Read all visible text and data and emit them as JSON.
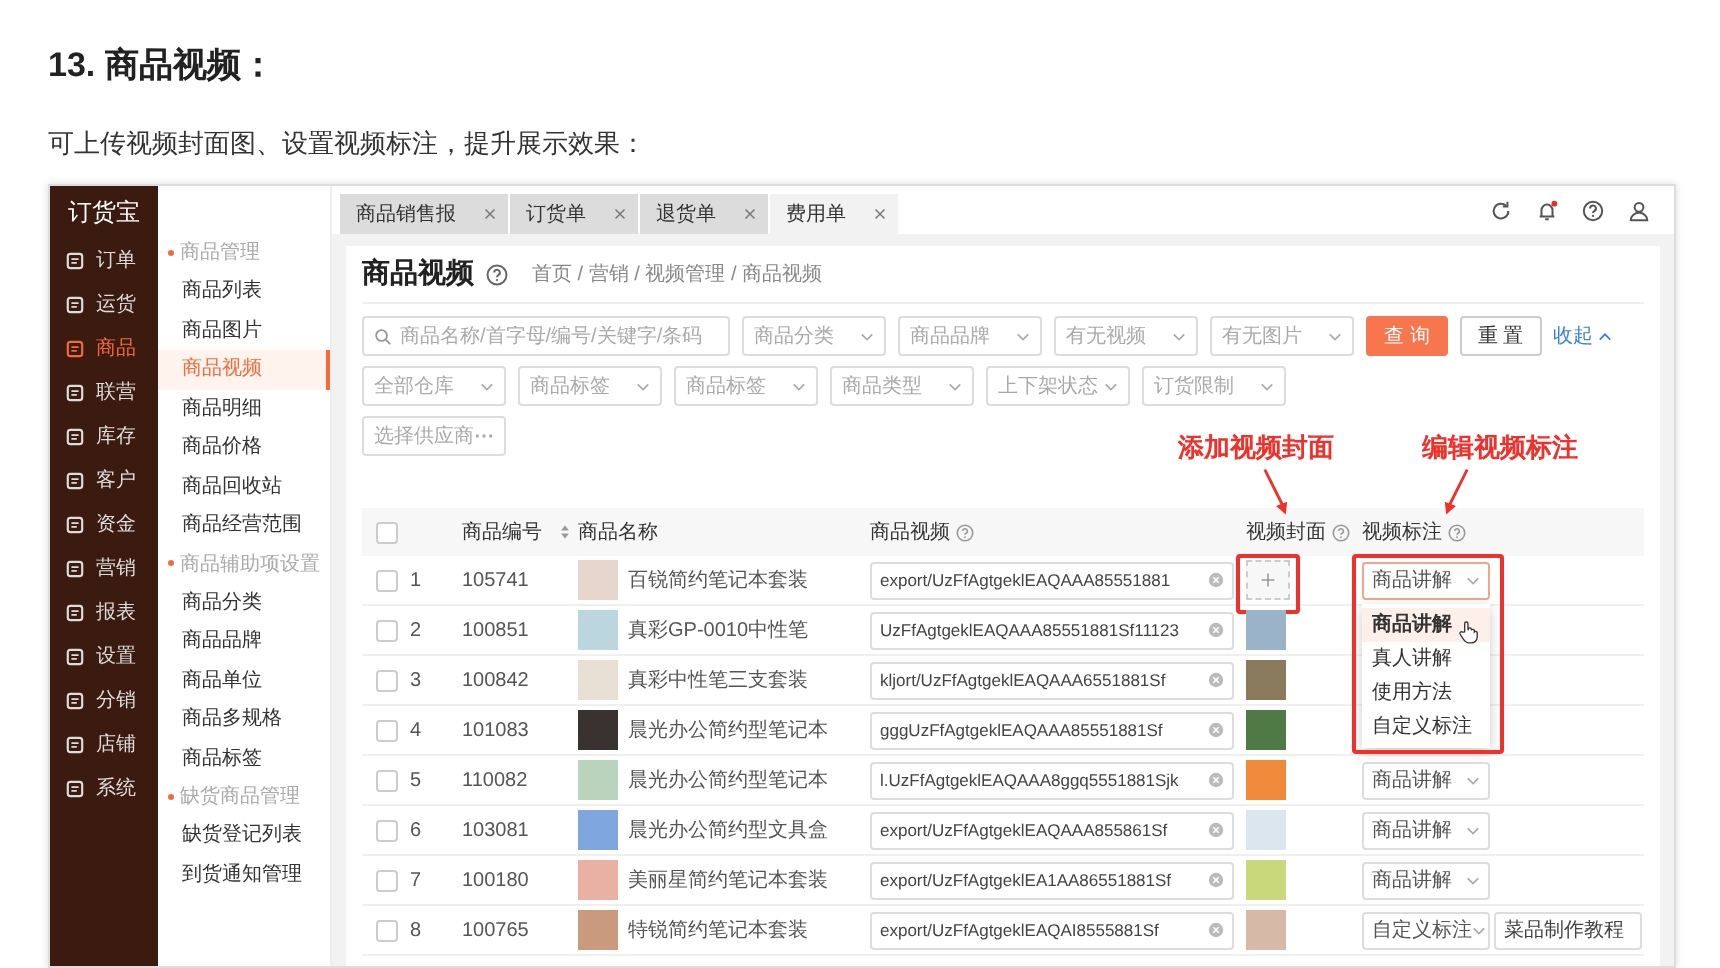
{
  "heading": "13. 商品视频：",
  "intro": "可上传视频封面图、设置视频标注，提升展示效果：",
  "app": {
    "logo": "订货宝",
    "nav": [
      {
        "label": "订单",
        "selected": false
      },
      {
        "label": "运货",
        "selected": false
      },
      {
        "label": "商品",
        "selected": true
      },
      {
        "label": "联营",
        "selected": false
      },
      {
        "label": "库存",
        "selected": false
      },
      {
        "label": "客户",
        "selected": false
      },
      {
        "label": "资金",
        "selected": false
      },
      {
        "label": "营销",
        "selected": false
      },
      {
        "label": "报表",
        "selected": false
      },
      {
        "label": "设置",
        "selected": false
      },
      {
        "label": "分销",
        "selected": false
      },
      {
        "label": "店铺",
        "selected": false
      },
      {
        "label": "系统",
        "selected": false
      }
    ],
    "submenu": [
      {
        "title": "商品管理",
        "items": [
          {
            "label": "商品列表",
            "selected": false
          },
          {
            "label": "商品图片",
            "selected": false
          },
          {
            "label": "商品视频",
            "selected": true
          },
          {
            "label": "商品明细",
            "selected": false
          },
          {
            "label": "商品价格",
            "selected": false
          },
          {
            "label": "商品回收站",
            "selected": false
          },
          {
            "label": "商品经营范围",
            "selected": false
          }
        ]
      },
      {
        "title": "商品辅助项设置",
        "items": [
          {
            "label": "商品分类",
            "selected": false
          },
          {
            "label": "商品品牌",
            "selected": false
          },
          {
            "label": "商品单位",
            "selected": false
          },
          {
            "label": "商品多规格",
            "selected": false
          },
          {
            "label": "商品标签",
            "selected": false
          }
        ]
      },
      {
        "title": "缺货商品管理",
        "items": [
          {
            "label": "缺货登记列表",
            "selected": false
          },
          {
            "label": "到货通知管理",
            "selected": false
          }
        ]
      }
    ],
    "tabs": [
      {
        "label": "商品销售报",
        "selected": false
      },
      {
        "label": "订货单",
        "selected": false
      },
      {
        "label": "退货单",
        "selected": false
      },
      {
        "label": "费用单",
        "selected": true
      }
    ],
    "page": {
      "title": "商品视频",
      "breadcrumb": "首页 / 营销 / 视频管理 / 商品视频"
    },
    "filter_rows": [
      [
        {
          "kind": "search",
          "placeholder": "商品名称/首字母/编号/关键字/条码"
        },
        {
          "kind": "select",
          "placeholder": "商品分类"
        },
        {
          "kind": "select",
          "placeholder": "商品品牌"
        },
        {
          "kind": "select",
          "placeholder": "有无视频"
        },
        {
          "kind": "select",
          "placeholder": "有无图片"
        },
        {
          "kind": "button",
          "label": "查 询",
          "primary": true
        },
        {
          "kind": "button",
          "label": "重 置",
          "primary": false
        },
        {
          "kind": "link",
          "label": "收起",
          "expanded": true
        }
      ],
      [
        {
          "kind": "select",
          "placeholder": "全部仓库"
        },
        {
          "kind": "select",
          "placeholder": "商品标签"
        },
        {
          "kind": "select",
          "placeholder": "商品标签"
        },
        {
          "kind": "select",
          "placeholder": "商品类型"
        },
        {
          "kind": "select",
          "placeholder": "上下架状态"
        },
        {
          "kind": "select",
          "placeholder": "订货限制"
        }
      ],
      [
        {
          "kind": "picker",
          "placeholder": "选择供应商"
        }
      ]
    ],
    "table": {
      "all_checked": false,
      "columns": [
        {
          "label": "商品编号",
          "kind": "sortable"
        },
        {
          "label": "商品名称",
          "kind": "plain"
        },
        {
          "label": "商品视频",
          "kind": "help"
        },
        {
          "label": "视频封面",
          "kind": "help"
        },
        {
          "label": "视频标注",
          "kind": "help"
        }
      ],
      "rows": [
        {
          "checked": false,
          "index": "1",
          "code": "105741",
          "name": "百锐简约笔记本套装",
          "video": "export/UzFfAgtgeklEAQAAA85551881",
          "kind": "upload",
          "label": "商品讲解",
          "menu_open": true
        },
        {
          "checked": false,
          "index": "2",
          "code": "100851",
          "name": "真彩GP-0010中性笔",
          "video": "UzFfAgtgeklEAQAAA85551881Sf11123",
          "kind": "photo"
        },
        {
          "checked": false,
          "index": "3",
          "code": "100842",
          "name": "真彩中性笔三支套装",
          "video": "kljort/UzFfAgtgeklEAQAAA6551881Sf",
          "kind": "photo"
        },
        {
          "checked": false,
          "index": "4",
          "code": "101083",
          "name": "晨光办公简约型笔记本",
          "video": "gggUzFfAgtgeklEAQAAA85551881Sf",
          "kind": "photo"
        },
        {
          "checked": false,
          "index": "5",
          "code": "110082",
          "name": "晨光办公简约型笔记本",
          "video": "l.UzFfAgtgeklEAQAAA8ggq5551881Sjk",
          "kind": "photo",
          "label": "商品讲解"
        },
        {
          "checked": false,
          "index": "6",
          "code": "103081",
          "name": "晨光办公简约型文具盒",
          "video": "export/UzFfAgtgeklEAQAAA855861Sf",
          "kind": "photo",
          "label": "商品讲解"
        },
        {
          "checked": false,
          "index": "7",
          "code": "100180",
          "name": "美丽星简约笔记本套装",
          "video": "export/UzFfAgtgeklEA1AA86551881Sf",
          "kind": "photo",
          "label": "商品讲解"
        },
        {
          "checked": false,
          "index": "8",
          "code": "100765",
          "name": "特锐简约笔记本套装",
          "video": "export/UzFfAgtgeklEAQAI8555881Sf",
          "kind": "photo",
          "label": "自定义标注",
          "note": "菜品制作教程"
        }
      ]
    },
    "label_menu": [
      {
        "label": "商品讲解",
        "selected": true
      },
      {
        "label": "真人讲解",
        "selected": false
      },
      {
        "label": "使用方法",
        "selected": false
      },
      {
        "label": "自定义标注",
        "selected": false
      }
    ]
  },
  "annotations": [
    "添加视频封面",
    "编辑视频标注"
  ]
}
